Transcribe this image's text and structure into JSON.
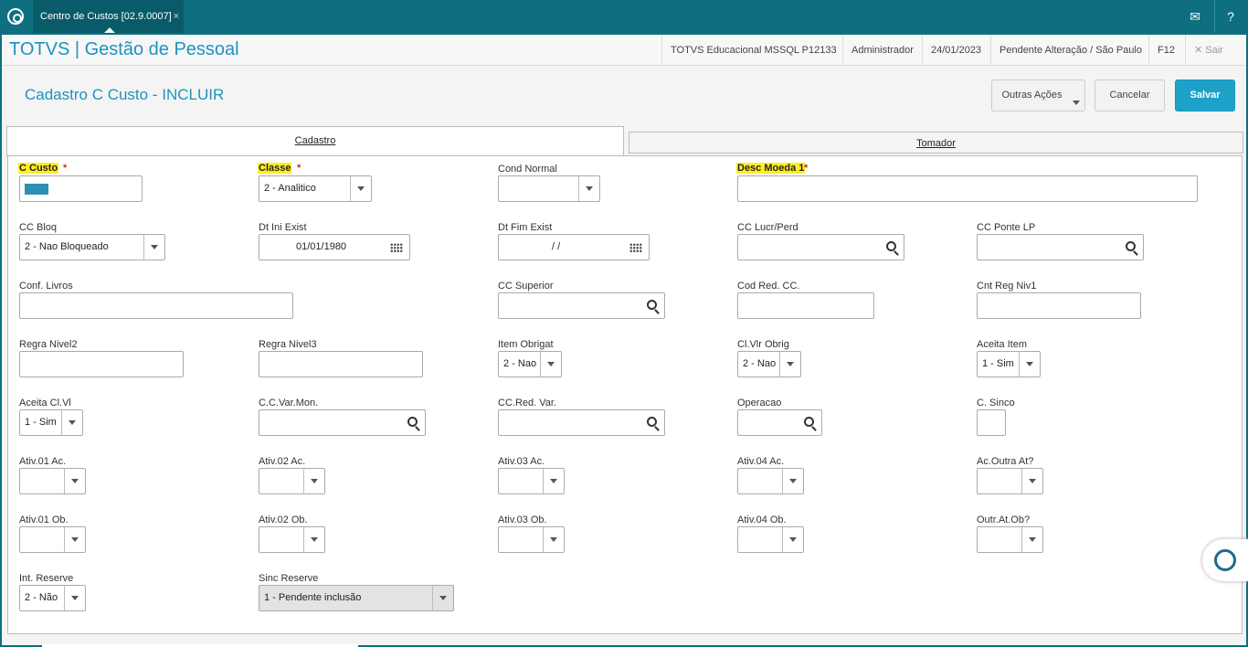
{
  "topbar": {
    "tab_label": "Centro de Custos [02.9.0007]",
    "tab_close": "×",
    "mail_icon": "mail-icon",
    "help_icon": "help-icon"
  },
  "header": {
    "app_title": "TOTVS | Gestão de Pessoal",
    "environment": "TOTVS Educacional MSSQL P12133",
    "user": "Administrador",
    "date": "24/01/2023",
    "status": "Pendente Alteração / São Paulo",
    "shortcut": "F12",
    "exit_label": "Sair"
  },
  "page": {
    "title": "Cadastro C Custo - INCLUIR",
    "other_actions": "Outras Ações",
    "cancel": "Cancelar",
    "save": "Salvar"
  },
  "tabs": [
    {
      "label": "Cadastro",
      "active": true
    },
    {
      "label": "Tomador",
      "active": false
    }
  ],
  "fields": {
    "c_custo": {
      "label": "C Custo",
      "value": ""
    },
    "classe": {
      "label": "Classe",
      "value": "2 - Analitico"
    },
    "cond_normal": {
      "label": "Cond Normal",
      "value": ""
    },
    "desc_moeda1": {
      "label": "Desc Moeda 1",
      "value": ""
    },
    "cc_bloq": {
      "label": "CC Bloq",
      "value": "2 - Nao Bloqueado"
    },
    "dt_ini_exist": {
      "label": "Dt Ini Exist",
      "value": "01/01/1980"
    },
    "dt_fim_exist": {
      "label": "Dt Fim Exist",
      "value": "/ /"
    },
    "cc_lucr_perd": {
      "label": "CC Lucr/Perd",
      "value": ""
    },
    "cc_ponte_lp": {
      "label": "CC Ponte LP",
      "value": ""
    },
    "conf_livros": {
      "label": "Conf. Livros",
      "value": ""
    },
    "cc_superior": {
      "label": "CC Superior",
      "value": ""
    },
    "cod_red_cc": {
      "label": "Cod Red. CC.",
      "value": ""
    },
    "cnt_reg_niv1": {
      "label": "Cnt Reg Niv1",
      "value": ""
    },
    "regra_nivel2": {
      "label": "Regra Nivel2",
      "value": ""
    },
    "regra_nivel3": {
      "label": "Regra Nivel3",
      "value": ""
    },
    "item_obrigat": {
      "label": "Item Obrigat",
      "value": "2 - Nao"
    },
    "cl_vlr_obrig": {
      "label": "Cl.Vlr Obrig",
      "value": "2 - Nao"
    },
    "aceita_item": {
      "label": "Aceita Item",
      "value": "1 - Sim"
    },
    "aceita_cl_vl": {
      "label": "Aceita Cl.Vl",
      "value": "1 - Sim"
    },
    "cc_var_mon": {
      "label": "C.C.Var.Mon.",
      "value": ""
    },
    "cc_red_var": {
      "label": "CC.Red. Var.",
      "value": ""
    },
    "operacao": {
      "label": "Operacao",
      "value": ""
    },
    "c_sinco": {
      "label": "C. Sinco",
      "value": ""
    },
    "ativ01_ac": {
      "label": "Ativ.01 Ac.",
      "value": ""
    },
    "ativ02_ac": {
      "label": "Ativ.02 Ac.",
      "value": ""
    },
    "ativ03_ac": {
      "label": "Ativ.03 Ac.",
      "value": ""
    },
    "ativ04_ac": {
      "label": "Ativ.04 Ac.",
      "value": ""
    },
    "ac_outra_at": {
      "label": "Ac.Outra At?",
      "value": ""
    },
    "ativ01_ob": {
      "label": "Ativ.01 Ob.",
      "value": ""
    },
    "ativ02_ob": {
      "label": "Ativ.02 Ob.",
      "value": ""
    },
    "ativ03_ob": {
      "label": "Ativ.03 Ob.",
      "value": ""
    },
    "ativ04_ob": {
      "label": "Ativ.04 Ob.",
      "value": ""
    },
    "outr_at_ob": {
      "label": "Outr.At.Ob?",
      "value": ""
    },
    "int_reserve": {
      "label": "Int. Reserve",
      "value": "2 - Não"
    },
    "sinc_reserve": {
      "label": "Sinc Reserve",
      "value": "1 - Pendente inclusão"
    }
  },
  "required_mark": "*"
}
